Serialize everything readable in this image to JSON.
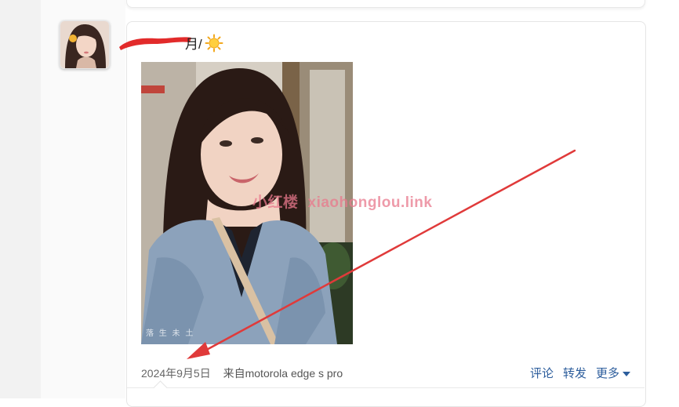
{
  "post": {
    "text": "月/",
    "emoji_icon": "sun-icon",
    "date": "2024年9月5日",
    "source": "来自motorola edge s pro",
    "photo_caption": "落 生 未 土"
  },
  "watermark": {
    "cn": "小红楼",
    "url": "xiaohonglou.link"
  },
  "actions": {
    "comment": "评论",
    "repost": "转发",
    "more": "更多"
  },
  "colors": {
    "link": "#2c5d9c",
    "annotation_red": "#e03a3a",
    "watermark": "#e8788c"
  }
}
